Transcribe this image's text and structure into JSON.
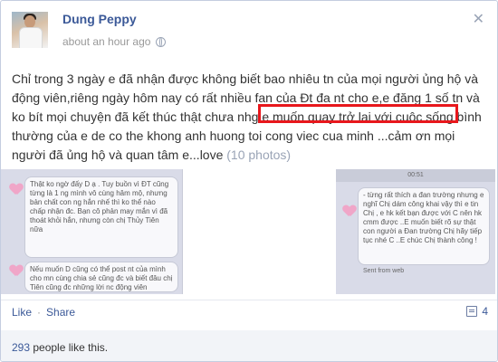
{
  "post": {
    "author": "Dung Peppy",
    "timestamp": "about an hour ago",
    "text_before": "Chỉ trong 3 ngày e đã nhận được không biết bao nhiêu tn của mọi người ủng hộ và động viên,riêng ngày hôm nay có rất nhiều fan của Đt đa nt cho e,e đăng 1 số tn và ko bít mọi chuyện đã kết thúc thật chưa nhg e muốn quay trở lại với cuộc sống bình thường của e de co the khong anh huong toi cong viec cua minh ...cảm ơn mọi người đã ủng hộ và quan tâm e...love",
    "photo_count": "(10 photos)",
    "close_icon": "close-icon",
    "privacy_icon": "globe-icon"
  },
  "photos": {
    "left": {
      "bubble1": "Thật ko ngờ đấy D ạ . Tuy buồn vì ĐT cũng từng là 1 ng mình vô cùng hâm mộ, nhưng bản chất con ng hắn nhế thì ko thể nào chấp nhận đc. Bạn cô phản may mắn vì đã thoát khỏi hắn, nhưng còn chị Thủy Tiên nữa",
      "bubble2": "Nếu muốn D cũng có thể post nt của mình cho mn cùng chia sẻ cũng đc và biết đâu chị Tiên cũng đc những lời nc động viên"
    },
    "right": {
      "time": "00:51",
      "bubble1": "- từng rất thích a đan trường nhưng e nghĩ Chị dám công khai vậy thì e tin Chị , e hk kết bạn được với C nên hk cmm được ..E muốn biết rõ sự thật con người a Đan trường Chị hãy tiếp tục nhé C ..E chúc Chị thành công !",
      "footer": "Sent from web"
    }
  },
  "actions": {
    "like": "Like",
    "separator": "·",
    "share": "Share",
    "comment_count": "4",
    "comment_icon": "comment-icon"
  },
  "likes": {
    "count": "293",
    "label": " people like this."
  }
}
